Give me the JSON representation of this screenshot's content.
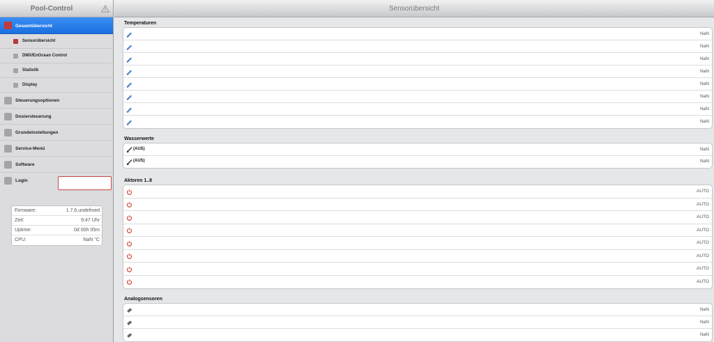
{
  "sidebar": {
    "title": "Pool-Control",
    "warning_icon": "warning-triangle-icon",
    "items": [
      {
        "label": "Gesamtübersicht",
        "level": 0,
        "active": true
      },
      {
        "label": "Sensorübersicht",
        "level": 1,
        "bullet": "red"
      },
      {
        "label": "DMX/EnOcean Control",
        "level": 1,
        "bullet": "gray"
      },
      {
        "label": "Statistik",
        "level": 1,
        "bullet": "gray"
      },
      {
        "label": "Display",
        "level": 1,
        "bullet": "gray"
      },
      {
        "label": "Steuerungsoptionen",
        "level": 0
      },
      {
        "label": "Dosiersteuerung",
        "level": 0
      },
      {
        "label": "Grundeinstellungen",
        "level": 0
      },
      {
        "label": "Service-Menü",
        "level": 0
      },
      {
        "label": "Software",
        "level": 0
      },
      {
        "label": "Login",
        "level": 0
      }
    ],
    "login_value": "",
    "info": [
      {
        "key": "Firmware:",
        "value": "1.7.6.undefined"
      },
      {
        "key": "Zeit:",
        "value": "9:47 Uhr"
      },
      {
        "key": "Uptime:",
        "value": "0d 00h 05m"
      },
      {
        "key": "CPU:",
        "value": "NaN °C"
      }
    ]
  },
  "main": {
    "title": "Sensorübersicht",
    "sections": [
      {
        "title": "Temperaturen",
        "icon": "thermometer-icon",
        "rows": [
          {
            "label": "",
            "value": "NaN"
          },
          {
            "label": "",
            "value": "NaN"
          },
          {
            "label": "",
            "value": "NaN"
          },
          {
            "label": "",
            "value": "NaN"
          },
          {
            "label": "",
            "value": "NaN"
          },
          {
            "label": "",
            "value": "NaN"
          },
          {
            "label": "",
            "value": "NaN"
          },
          {
            "label": "",
            "value": "NaN"
          }
        ]
      },
      {
        "title": "Wasserwerte",
        "icon": "probe-icon",
        "rows": [
          {
            "label": "(AUS)",
            "value": "NaN"
          },
          {
            "label": "(AUS)",
            "value": "NaN"
          }
        ]
      },
      {
        "title": "Aktoren 1..8",
        "icon": "power-icon",
        "icon_color": "#d0392b",
        "rows": [
          {
            "label": "",
            "value": "AUTO"
          },
          {
            "label": "",
            "value": "AUTO"
          },
          {
            "label": "",
            "value": "AUTO"
          },
          {
            "label": "",
            "value": "AUTO"
          },
          {
            "label": "",
            "value": "AUTO"
          },
          {
            "label": "",
            "value": "AUTO"
          },
          {
            "label": "",
            "value": "AUTO"
          },
          {
            "label": "",
            "value": "AUTO"
          }
        ]
      },
      {
        "title": "Analogsensoren",
        "icon": "sensor-icon",
        "rows": [
          {
            "label": "",
            "value": "NaN"
          },
          {
            "label": "",
            "value": "NaN"
          },
          {
            "label": "",
            "value": "NaN"
          }
        ]
      }
    ]
  }
}
